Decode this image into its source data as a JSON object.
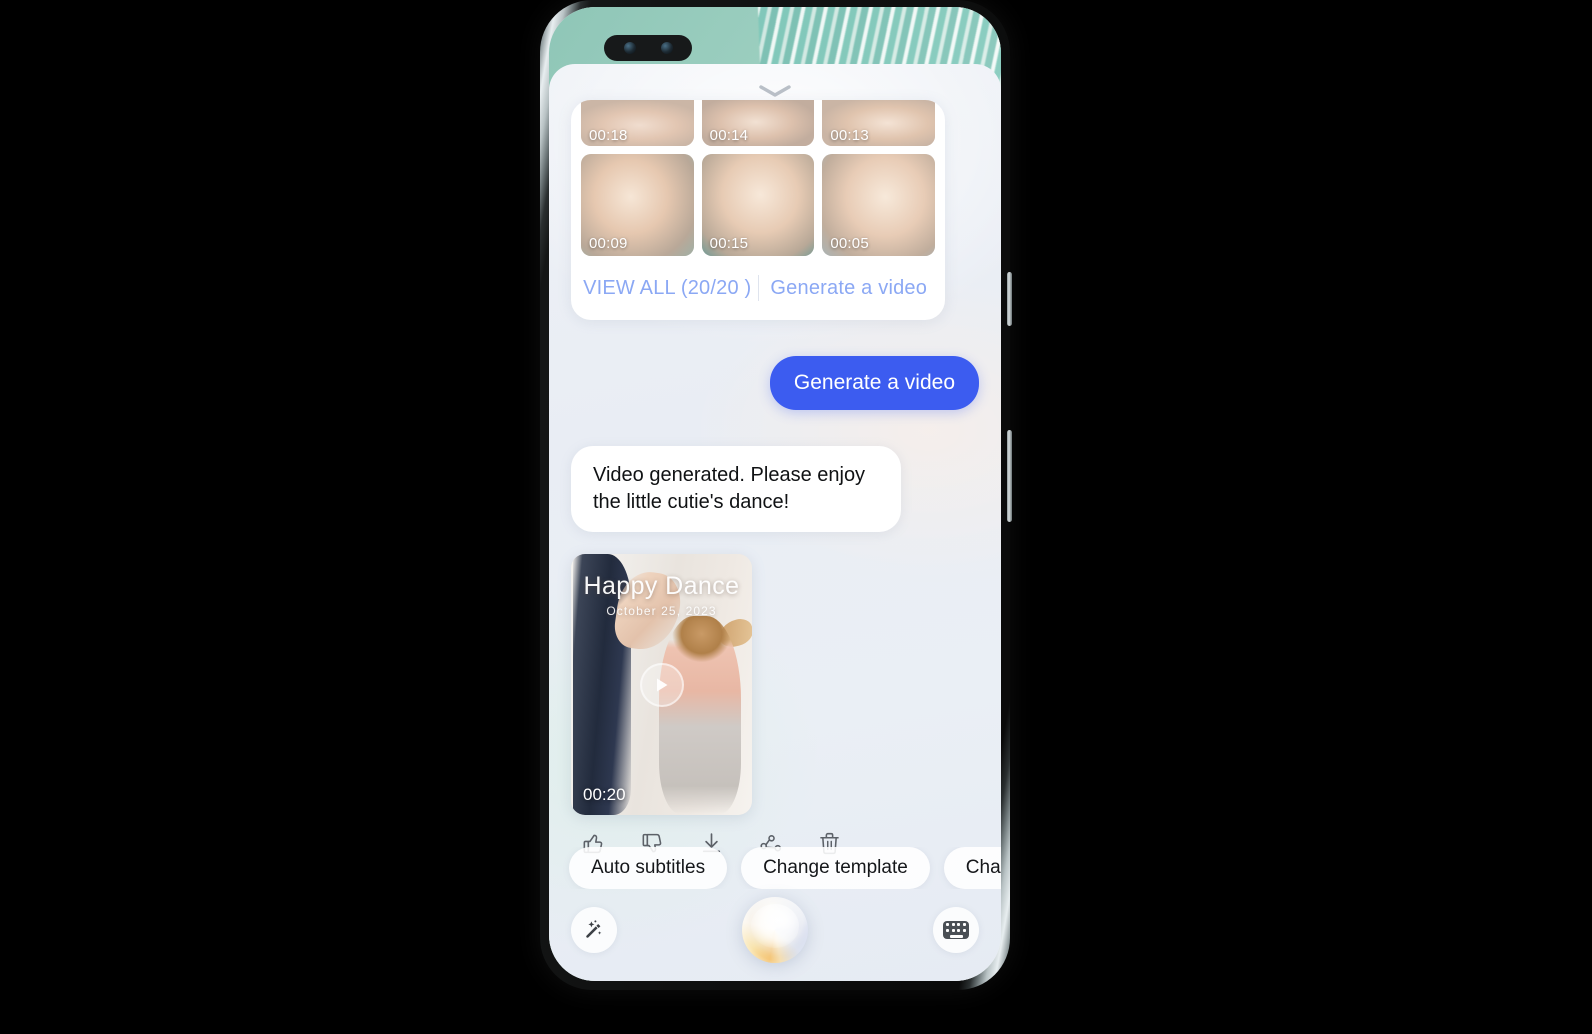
{
  "device": {
    "camera": {
      "lens_count": 2
    },
    "side_buttons": [
      "power",
      "volume"
    ]
  },
  "assistant_panel": {
    "handle_icon": "chevron-down-icon"
  },
  "media_card": {
    "thumbnails": [
      {
        "duration": "00:18",
        "row": "top",
        "photo": "ph-girl1"
      },
      {
        "duration": "00:14",
        "row": "top",
        "photo": "ph-girl2"
      },
      {
        "duration": "00:13",
        "row": "top",
        "photo": "ph-girl3"
      },
      {
        "duration": "00:09",
        "row": "bottom",
        "photo": "ph-girl4"
      },
      {
        "duration": "00:15",
        "row": "bottom",
        "photo": "ph-girl5"
      },
      {
        "duration": "00:05",
        "row": "bottom",
        "photo": "ph-girl6"
      }
    ],
    "view_all_label": "VIEW ALL (20/20 )",
    "generate_label": "Generate a video",
    "selected_count": 20,
    "total_count": 20,
    "link_color": "#8ba8f4"
  },
  "messages": {
    "user": {
      "text": "Generate a video",
      "bubble_color": "#3c5cf0",
      "text_color": "#ffffff"
    },
    "assistant": {
      "text": "Video generated. Please enjoy the little cutie's dance!",
      "bubble_color": "#ffffff",
      "text_color": "#101214"
    }
  },
  "generated_video": {
    "title": "Happy Dance",
    "date": "October 25, 2023",
    "duration": "00:20",
    "play_icon": "play-icon"
  },
  "feedback_actions": [
    {
      "name": "thumbs-up-icon",
      "label": "Like"
    },
    {
      "name": "thumbs-down-icon",
      "label": "Dislike"
    },
    {
      "name": "download-icon",
      "label": "Download"
    },
    {
      "name": "share-icon",
      "label": "Share"
    },
    {
      "name": "delete-icon",
      "label": "Delete"
    }
  ],
  "suggestion_chips": [
    {
      "label": "Auto subtitles"
    },
    {
      "label": "Change template"
    },
    {
      "label": "Change music"
    }
  ],
  "bottom_bar": {
    "left_icon": "magic-wand-icon",
    "center_icon": "voice-orb-icon",
    "right_icon": "keyboard-icon"
  }
}
